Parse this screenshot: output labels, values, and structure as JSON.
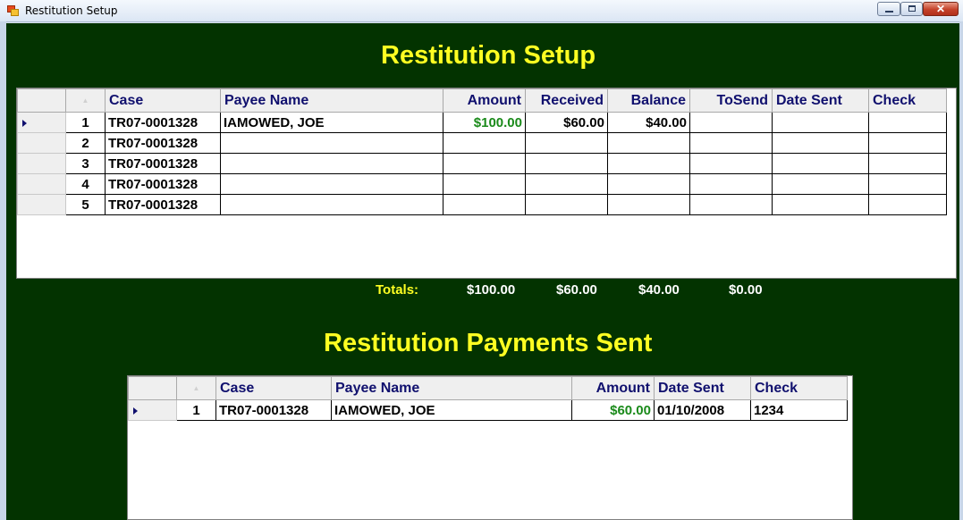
{
  "window": {
    "title": "Restitution Setup",
    "close_glyph": "✕"
  },
  "colors": {
    "background": "#033300",
    "heading": "#ffff22",
    "header_text": "#10106e",
    "money_green": "#1a8a1a"
  },
  "setup": {
    "heading": "Restitution Setup",
    "columns": [
      "Case",
      "Payee Name",
      "Amount",
      "Received",
      "Balance",
      "ToSend",
      "Date Sent",
      "Check"
    ],
    "rows": [
      {
        "num": "1",
        "case": "TR07-0001328",
        "payee": "IAMOWED, JOE",
        "amount": "$100.00",
        "received": "$60.00",
        "balance": "$40.00",
        "tosend": "",
        "date_sent": "",
        "check": ""
      },
      {
        "num": "2",
        "case": "TR07-0001328",
        "payee": "",
        "amount": "",
        "received": "",
        "balance": "",
        "tosend": "",
        "date_sent": "",
        "check": ""
      },
      {
        "num": "3",
        "case": "TR07-0001328",
        "payee": "",
        "amount": "",
        "received": "",
        "balance": "",
        "tosend": "",
        "date_sent": "",
        "check": ""
      },
      {
        "num": "4",
        "case": "TR07-0001328",
        "payee": "",
        "amount": "",
        "received": "",
        "balance": "",
        "tosend": "",
        "date_sent": "",
        "check": ""
      },
      {
        "num": "5",
        "case": "TR07-0001328",
        "payee": "",
        "amount": "",
        "received": "",
        "balance": "",
        "tosend": "",
        "date_sent": "",
        "check": ""
      }
    ],
    "totals": {
      "label": "Totals:",
      "amount": "$100.00",
      "received": "$60.00",
      "balance": "$40.00",
      "tosend": "$0.00"
    }
  },
  "sent": {
    "heading": "Restitution Payments Sent",
    "columns": [
      "Case",
      "Payee Name",
      "Amount",
      "Date Sent",
      "Check"
    ],
    "rows": [
      {
        "num": "1",
        "case": "TR07-0001328",
        "payee": "IAMOWED, JOE",
        "amount": "$60.00",
        "date_sent": "01/10/2008",
        "check": "1234"
      }
    ]
  }
}
